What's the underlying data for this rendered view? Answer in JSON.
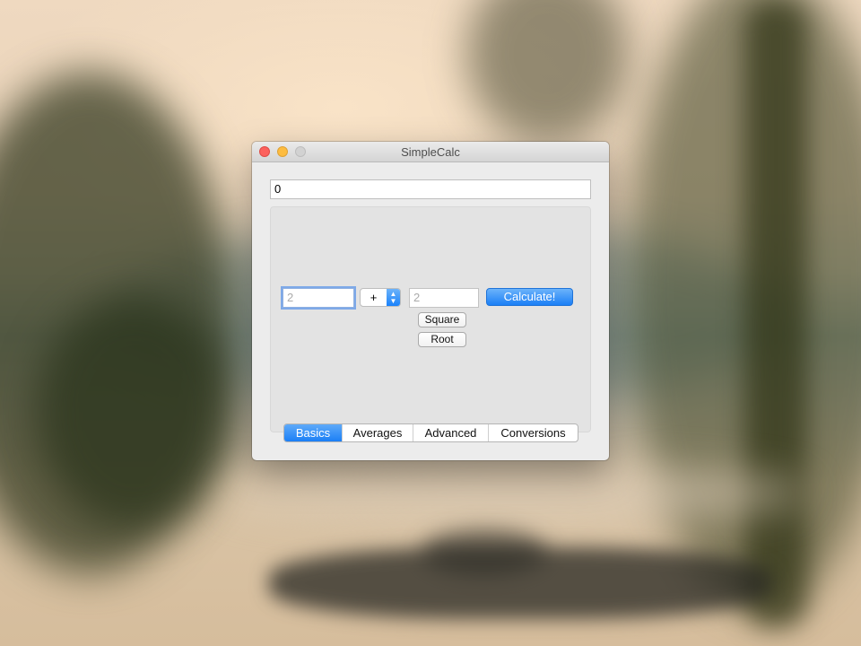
{
  "window": {
    "title": "SimpleCalc"
  },
  "display": {
    "value": "0"
  },
  "calculator": {
    "operand1_placeholder": "2",
    "operand2_placeholder": "2",
    "operator": "+",
    "calculate_label": "Calculate!",
    "square_label": "Square",
    "root_label": "Root"
  },
  "tabs": [
    {
      "label": "Basics",
      "active": true
    },
    {
      "label": "Averages",
      "active": false
    },
    {
      "label": "Advanced",
      "active": false
    },
    {
      "label": "Conversions",
      "active": false
    }
  ],
  "icons": {
    "close": "close-icon",
    "minimize": "minimize-icon",
    "zoom": "zoom-icon",
    "select_arrows": "chevron-updown-icon"
  },
  "colors": {
    "accent": "#1b7ff6",
    "close": "#fc615d",
    "minimize": "#fdbc40",
    "zoom_disabled": "#d2d2d2"
  }
}
